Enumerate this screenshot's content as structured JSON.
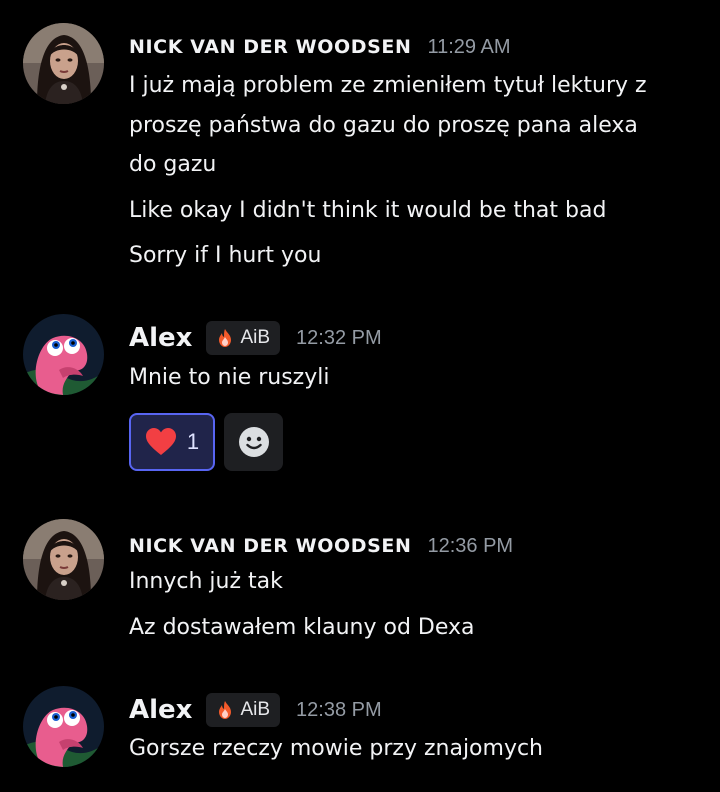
{
  "messages": [
    {
      "author": "NICK VAN DER WOODSEN",
      "time": "11:29 AM",
      "lines": [
        "I już mają problem ze zmieniłem tytuł lektury z",
        "proszę państwa do gazu do proszę pana alexa",
        "do gazu",
        "Like okay I didn't think it would be that bad",
        "Sorry if I hurt you"
      ]
    },
    {
      "author": "Alex",
      "tag": "AiB",
      "time": "12:32 PM",
      "lines": [
        "Mnie to nie ruszyli"
      ],
      "reaction": {
        "emoji": "heart",
        "count": "1"
      },
      "add_reaction_icon": "smiley-icon"
    },
    {
      "author": "NICK VAN DER WOODSEN",
      "time": "12:36 PM",
      "lines": [
        "Innych już tak",
        "Az dostawałem klauny od Dexa"
      ]
    },
    {
      "author": "Alex",
      "tag": "AiB",
      "time": "12:38 PM",
      "lines": [
        "Gorsze rzeczy mowie przy znajomych"
      ]
    }
  ],
  "colors": {
    "background": "#000000",
    "text": "#f2f3f5",
    "timestamp": "#949ba4",
    "reaction_active_bg": "#20244a",
    "reaction_active_border": "#5865f2",
    "heart": "#f23f43"
  }
}
